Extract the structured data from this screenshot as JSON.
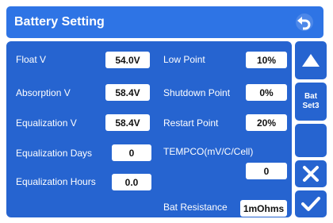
{
  "header": {
    "title": "Battery Setting"
  },
  "fields_left": [
    {
      "label": "Float V",
      "value": "54.0V"
    },
    {
      "label": "Absorption V",
      "value": "58.4V"
    },
    {
      "label": "Equalization V",
      "value": "58.4V"
    },
    {
      "label": "Equalization Days",
      "value": "0"
    },
    {
      "label": "Equalization Hours",
      "value": "0.0"
    }
  ],
  "fields_right": [
    {
      "label": "Low Point",
      "value": "10%"
    },
    {
      "label": "Shutdown Point",
      "value": "0%"
    },
    {
      "label": "Restart Point",
      "value": "20%"
    }
  ],
  "tempco": {
    "label": "TEMPCO(mV/C/Cell)",
    "value": "0"
  },
  "bat_resistance": {
    "label": "Bat Resistance",
    "value": "1mOhms"
  },
  "side": {
    "bat_set_label_line1": "Bat",
    "bat_set_label_line2": "Set3"
  },
  "icons": {
    "back": "back-arrow-icon",
    "up": "up-arrow-icon",
    "cancel": "close-icon",
    "confirm": "check-icon"
  },
  "colors": {
    "title_bar": "#2e74e5",
    "panel": "#2664d0",
    "text": "#ffffff"
  }
}
